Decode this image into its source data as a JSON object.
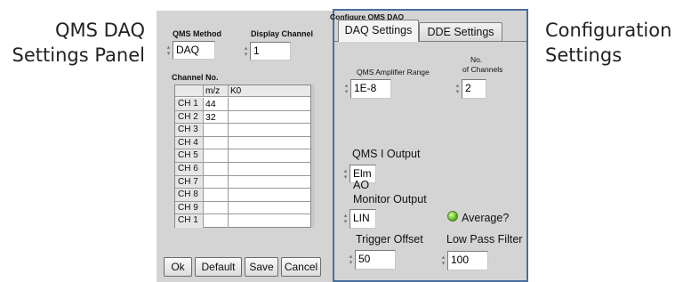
{
  "callouts": {
    "left": [
      "QMS DAQ",
      "Settings Panel"
    ],
    "right": [
      "Configuration",
      "Settings"
    ]
  },
  "left_panel": {
    "qms_method": {
      "label": "QMS Method",
      "value": "DAQ"
    },
    "display_channel": {
      "label": "Display Channel",
      "value": "1"
    },
    "table": {
      "title": "Channel  No.",
      "columns": [
        "m/z",
        "K0"
      ],
      "rows": [
        {
          "channel": "CH 1",
          "mz": "44"
        },
        {
          "channel": "CH 2",
          "mz": "32"
        },
        {
          "channel": "CH 3",
          "mz": ""
        },
        {
          "channel": "CH 4",
          "mz": ""
        },
        {
          "channel": "CH 5",
          "mz": ""
        },
        {
          "channel": "CH 6",
          "mz": ""
        },
        {
          "channel": "CH 7",
          "mz": ""
        },
        {
          "channel": "CH 8",
          "mz": ""
        },
        {
          "channel": "CH 9",
          "mz": ""
        },
        {
          "channel": "CH 1",
          "mz": ""
        }
      ]
    },
    "buttons": {
      "ok": "Ok",
      "default": "Default",
      "save": "Save",
      "cancel": "Cancel"
    }
  },
  "config": {
    "group_label": "Configure QMS DAQ",
    "tabs": [
      {
        "label": "DAQ Settings",
        "selected": true
      },
      {
        "label": "DDE Settings",
        "selected": false
      }
    ],
    "amplifier_range": {
      "label": "QMS Amplifier Range",
      "value": "1E-8"
    },
    "num_channels": {
      "label_line1": "No.",
      "label_line2": "of Channels",
      "value": "2"
    },
    "qms_i_output": {
      "label": "QMS I Output",
      "value": "Elm"
    },
    "ao_monitor_output": {
      "label_line1": "AO",
      "label_line2": "Monitor Output",
      "value": "LIN"
    },
    "average": {
      "label": "Average?",
      "on": true,
      "color": "#5dbb22"
    },
    "trigger_offset": {
      "label": "Trigger Offset",
      "value": "50"
    },
    "low_pass_filter": {
      "label": "Low Pass Filter",
      "value": "100"
    }
  },
  "colors": {
    "panel_bg": "#d4d4d4",
    "tab_frame": "#4a6f9a"
  },
  "icons": {
    "spinner": "spinner-arrows-icon",
    "led": "average-led-icon"
  }
}
